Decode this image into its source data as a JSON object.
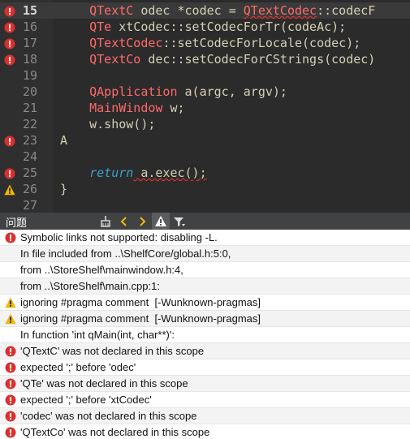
{
  "editor": {
    "lines": [
      {
        "num": "15",
        "marker": "error",
        "current": true,
        "tokens": [
          {
            "t": "    ",
            "c": "plain"
          },
          {
            "t": "QTextC",
            "c": "type"
          },
          {
            "t": " odec ",
            "c": "plain"
          },
          {
            "t": "*codec",
            "c": "plain"
          },
          {
            "t": " = ",
            "c": "plain"
          },
          {
            "t": "QTextCodec",
            "c": "type"
          },
          {
            "t": "::codecF",
            "c": "plain"
          }
        ]
      },
      {
        "num": "16",
        "marker": "error",
        "current": false,
        "tokens": [
          {
            "t": "    ",
            "c": "plain"
          },
          {
            "t": "QTe",
            "c": "type"
          },
          {
            "t": " xtCodec::setCodecForTr(codeAc);",
            "c": "plain"
          }
        ]
      },
      {
        "num": "17",
        "marker": "error",
        "current": false,
        "tokens": [
          {
            "t": "    ",
            "c": "plain"
          },
          {
            "t": "QTextCodec",
            "c": "type"
          },
          {
            "t": "::setCodecForLocale(codec);",
            "c": "plain"
          }
        ]
      },
      {
        "num": "18",
        "marker": "error",
        "current": false,
        "tokens": [
          {
            "t": "    ",
            "c": "plain"
          },
          {
            "t": "QTextCo",
            "c": "type"
          },
          {
            "t": " dec::setCodecForCStrings(codec)",
            "c": "plain"
          }
        ]
      },
      {
        "num": "19",
        "marker": "",
        "current": false,
        "tokens": []
      },
      {
        "num": "20",
        "marker": "",
        "current": false,
        "tokens": [
          {
            "t": "    ",
            "c": "plain"
          },
          {
            "t": "QApplication",
            "c": "type"
          },
          {
            "t": " a(argc, argv);",
            "c": "plain"
          }
        ]
      },
      {
        "num": "21",
        "marker": "",
        "current": false,
        "tokens": [
          {
            "t": "    ",
            "c": "plain"
          },
          {
            "t": "MainWindow",
            "c": "type"
          },
          {
            "t": " w;",
            "c": "plain"
          }
        ]
      },
      {
        "num": "22",
        "marker": "",
        "current": false,
        "tokens": [
          {
            "t": "    ",
            "c": "plain"
          },
          {
            "t": "w.show();",
            "c": "plain"
          }
        ]
      },
      {
        "num": "23",
        "marker": "error",
        "current": false,
        "tokens": [
          {
            "t": "A",
            "c": "plain"
          }
        ]
      },
      {
        "num": "24",
        "marker": "",
        "current": false,
        "tokens": []
      },
      {
        "num": "25",
        "marker": "error",
        "current": false,
        "tokens": [
          {
            "t": "    ",
            "c": "plain"
          },
          {
            "t": "return",
            "c": "kw"
          },
          {
            "t": " a.exec();",
            "c": "plain"
          }
        ]
      },
      {
        "num": "26",
        "marker": "warning",
        "current": false,
        "tokens": [
          {
            "t": "}",
            "c": "plain"
          }
        ]
      },
      {
        "num": "27",
        "marker": "",
        "current": false,
        "tokens": []
      }
    ]
  },
  "issues_bar": {
    "title": "问题",
    "buttons": [
      "clear-issues",
      "previous",
      "next",
      "warnings-filter",
      "filter"
    ]
  },
  "issues": [
    {
      "severity": "error",
      "text": "Symbolic links not supported: disabling -L."
    },
    {
      "severity": "",
      "text": "In file included from ..\\ShelfCore/global.h:5:0,"
    },
    {
      "severity": "",
      "text": "from ..\\StoreShelf\\mainwindow.h:4,"
    },
    {
      "severity": "",
      "text": "from ..\\StoreShelf\\main.cpp:1:"
    },
    {
      "severity": "warning",
      "text": "ignoring #pragma comment  [-Wunknown-pragmas]"
    },
    {
      "severity": "warning",
      "text": "ignoring #pragma comment  [-Wunknown-pragmas]"
    },
    {
      "severity": "",
      "text": "In function 'int qMain(int, char**)':"
    },
    {
      "severity": "error",
      "text": "'QTextC' was not declared in this scope"
    },
    {
      "severity": "error",
      "text": "expected ';' before 'odec'"
    },
    {
      "severity": "error",
      "text": "'QTe' was not declared in this scope"
    },
    {
      "severity": "error",
      "text": "expected ';' before 'xtCodec'"
    },
    {
      "severity": "error",
      "text": "'codec' was not declared in this scope"
    },
    {
      "severity": "error",
      "text": "'QTextCo' was not declared in this scope"
    }
  ],
  "colors": {
    "error": "#d9302f",
    "warning": "#f2b705"
  }
}
